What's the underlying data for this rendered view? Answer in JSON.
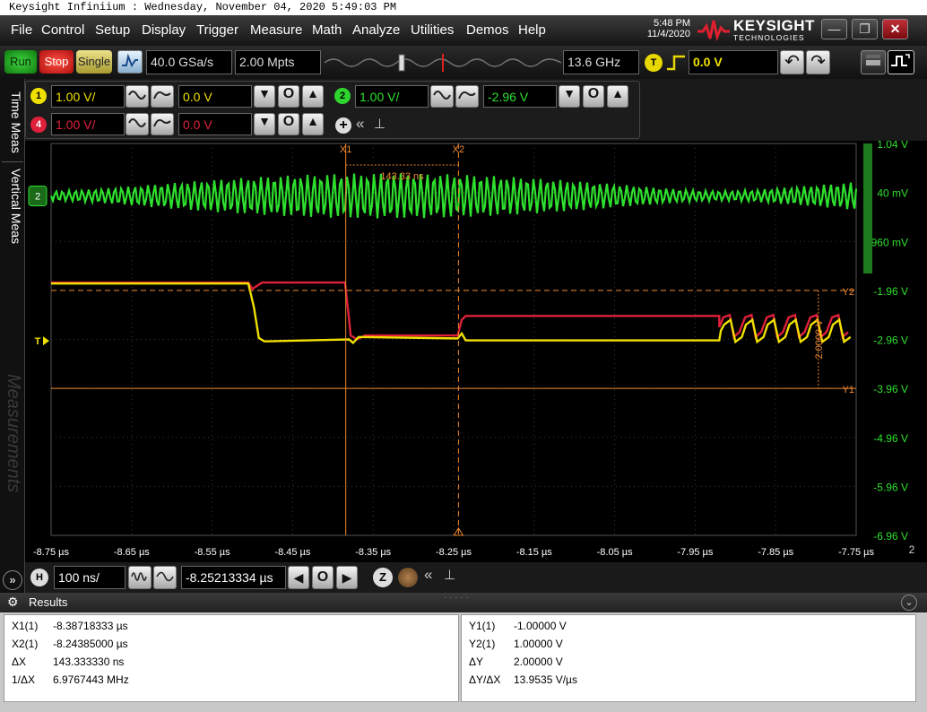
{
  "window": {
    "title": "Keysight Infiniium : Wednesday, November 04, 2020 5:49:03 PM"
  },
  "menu": [
    "File",
    "Control",
    "Setup",
    "Display",
    "Trigger",
    "Measure",
    "Math",
    "Analyze",
    "Utilities",
    "Demos",
    "Help"
  ],
  "clock": {
    "time": "5:48 PM",
    "date": "11/4/2020"
  },
  "brand": {
    "name": "KEYSIGHT",
    "sub": "TECHNOLOGIES"
  },
  "toolbar": {
    "run": "Run",
    "stop": "Stop",
    "single": "Single",
    "sample_rate": "40.0 GSa/s",
    "memory_depth": "2.00 Mpts",
    "bandwidth": "13.6 GHz",
    "trigger_badge": "T",
    "trigger_level": "0.0 V"
  },
  "channels": {
    "ch1": {
      "num": "1",
      "scale": "1.00 V/",
      "offset": "0.0 V",
      "color": "#f0e000"
    },
    "ch2": {
      "num": "2",
      "scale": "1.00 V/",
      "offset": "-2.96 V",
      "color": "#2ee02e"
    },
    "ch4": {
      "num": "4",
      "scale": "1.00 V/",
      "offset": "0.0 V",
      "color": "#e0203a"
    }
  },
  "side_tabs": {
    "time_meas": "Time Meas",
    "vertical_meas": "Vertical Meas",
    "measurements": "Measurements"
  },
  "scope": {
    "y_labels": [
      "1.04 V",
      "40 mV",
      "-960 mV",
      "-1.96 V",
      "-2.96 V",
      "-3.96 V",
      "-4.96 V",
      "-5.96 V",
      "-6.96 V"
    ],
    "x_labels": [
      "-8.75 µs",
      "-8.65 µs",
      "-8.55 µs",
      "-8.45 µs",
      "-8.35 µs",
      "-8.25 µs",
      "-8.15 µs",
      "-8.05 µs",
      "-7.95 µs",
      "-7.85 µs",
      "-7.75 µs"
    ],
    "x_suffix": "2",
    "cursor_x1": "X1",
    "cursor_x2": "X2",
    "cursor_y1": "Y1",
    "cursor_y2": "Y2",
    "delta_x": "143.33 ns",
    "delta_y": "2.0000 V",
    "ch2_marker": "2",
    "trig_marker": "T"
  },
  "horizontal": {
    "badge": "H",
    "scale": "100 ns/",
    "position": "-8.25213334 µs"
  },
  "results": {
    "title": "Results",
    "left": [
      {
        "k": "X1(1)",
        "v": "-8.38718333 µs"
      },
      {
        "k": "X2(1)",
        "v": "-8.24385000 µs"
      },
      {
        "k": "ΔX",
        "v": "143.333330 ns"
      },
      {
        "k": "1/ΔX",
        "v": "6.9767443 MHz"
      }
    ],
    "right": [
      {
        "k": "Y1(1)",
        "v": "-1.00000 V"
      },
      {
        "k": "Y2(1)",
        "v": "1.00000 V"
      },
      {
        "k": "ΔY",
        "v": "2.00000 V"
      },
      {
        "k": "ΔY/ΔX",
        "v": "13.9535 V/µs"
      }
    ]
  }
}
